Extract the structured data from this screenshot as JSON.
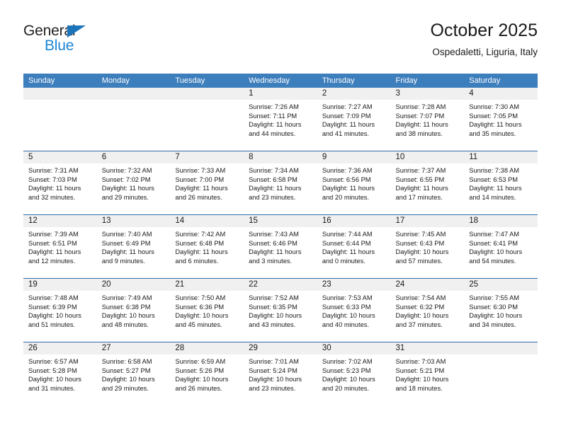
{
  "brand": {
    "name_part1": "General",
    "name_part2": "Blue",
    "accent_color": "#1c85d6",
    "triangle_color": "#1c74bb"
  },
  "header": {
    "title": "October 2025",
    "subtitle": "Ospedaletti, Liguria, Italy"
  },
  "theme": {
    "header_bg": "#3d7ebc",
    "date_band_bg": "#f0f0f0",
    "rule_color": "#2e6da4",
    "text_color": "#1a1a1a"
  },
  "weekdays": [
    "Sunday",
    "Monday",
    "Tuesday",
    "Wednesday",
    "Thursday",
    "Friday",
    "Saturday"
  ],
  "weeks": [
    {
      "days": [
        {
          "date": "",
          "info": ""
        },
        {
          "date": "",
          "info": ""
        },
        {
          "date": "",
          "info": ""
        },
        {
          "date": "1",
          "info": "Sunrise: 7:26 AM\nSunset: 7:11 PM\nDaylight: 11 hours\nand 44 minutes.",
          "sunrise": "7:26 AM",
          "sunset": "7:11 PM",
          "daylight": "11 hours and 44 minutes."
        },
        {
          "date": "2",
          "info": "Sunrise: 7:27 AM\nSunset: 7:09 PM\nDaylight: 11 hours\nand 41 minutes.",
          "sunrise": "7:27 AM",
          "sunset": "7:09 PM",
          "daylight": "11 hours and 41 minutes."
        },
        {
          "date": "3",
          "info": "Sunrise: 7:28 AM\nSunset: 7:07 PM\nDaylight: 11 hours\nand 38 minutes.",
          "sunrise": "7:28 AM",
          "sunset": "7:07 PM",
          "daylight": "11 hours and 38 minutes."
        },
        {
          "date": "4",
          "info": "Sunrise: 7:30 AM\nSunset: 7:05 PM\nDaylight: 11 hours\nand 35 minutes.",
          "sunrise": "7:30 AM",
          "sunset": "7:05 PM",
          "daylight": "11 hours and 35 minutes."
        }
      ]
    },
    {
      "days": [
        {
          "date": "5",
          "info": "Sunrise: 7:31 AM\nSunset: 7:03 PM\nDaylight: 11 hours\nand 32 minutes.",
          "sunrise": "7:31 AM",
          "sunset": "7:03 PM",
          "daylight": "11 hours and 32 minutes."
        },
        {
          "date": "6",
          "info": "Sunrise: 7:32 AM\nSunset: 7:02 PM\nDaylight: 11 hours\nand 29 minutes.",
          "sunrise": "7:32 AM",
          "sunset": "7:02 PM",
          "daylight": "11 hours and 29 minutes."
        },
        {
          "date": "7",
          "info": "Sunrise: 7:33 AM\nSunset: 7:00 PM\nDaylight: 11 hours\nand 26 minutes.",
          "sunrise": "7:33 AM",
          "sunset": "7:00 PM",
          "daylight": "11 hours and 26 minutes."
        },
        {
          "date": "8",
          "info": "Sunrise: 7:34 AM\nSunset: 6:58 PM\nDaylight: 11 hours\nand 23 minutes.",
          "sunrise": "7:34 AM",
          "sunset": "6:58 PM",
          "daylight": "11 hours and 23 minutes."
        },
        {
          "date": "9",
          "info": "Sunrise: 7:36 AM\nSunset: 6:56 PM\nDaylight: 11 hours\nand 20 minutes.",
          "sunrise": "7:36 AM",
          "sunset": "6:56 PM",
          "daylight": "11 hours and 20 minutes."
        },
        {
          "date": "10",
          "info": "Sunrise: 7:37 AM\nSunset: 6:55 PM\nDaylight: 11 hours\nand 17 minutes.",
          "sunrise": "7:37 AM",
          "sunset": "6:55 PM",
          "daylight": "11 hours and 17 minutes."
        },
        {
          "date": "11",
          "info": "Sunrise: 7:38 AM\nSunset: 6:53 PM\nDaylight: 11 hours\nand 14 minutes.",
          "sunrise": "7:38 AM",
          "sunset": "6:53 PM",
          "daylight": "11 hours and 14 minutes."
        }
      ]
    },
    {
      "days": [
        {
          "date": "12",
          "info": "Sunrise: 7:39 AM\nSunset: 6:51 PM\nDaylight: 11 hours\nand 12 minutes.",
          "sunrise": "7:39 AM",
          "sunset": "6:51 PM",
          "daylight": "11 hours and 12 minutes."
        },
        {
          "date": "13",
          "info": "Sunrise: 7:40 AM\nSunset: 6:49 PM\nDaylight: 11 hours\nand 9 minutes.",
          "sunrise": "7:40 AM",
          "sunset": "6:49 PM",
          "daylight": "11 hours and 9 minutes."
        },
        {
          "date": "14",
          "info": "Sunrise: 7:42 AM\nSunset: 6:48 PM\nDaylight: 11 hours\nand 6 minutes.",
          "sunrise": "7:42 AM",
          "sunset": "6:48 PM",
          "daylight": "11 hours and 6 minutes."
        },
        {
          "date": "15",
          "info": "Sunrise: 7:43 AM\nSunset: 6:46 PM\nDaylight: 11 hours\nand 3 minutes.",
          "sunrise": "7:43 AM",
          "sunset": "6:46 PM",
          "daylight": "11 hours and 3 minutes."
        },
        {
          "date": "16",
          "info": "Sunrise: 7:44 AM\nSunset: 6:44 PM\nDaylight: 11 hours\nand 0 minutes.",
          "sunrise": "7:44 AM",
          "sunset": "6:44 PM",
          "daylight": "11 hours and 0 minutes."
        },
        {
          "date": "17",
          "info": "Sunrise: 7:45 AM\nSunset: 6:43 PM\nDaylight: 10 hours\nand 57 minutes.",
          "sunrise": "7:45 AM",
          "sunset": "6:43 PM",
          "daylight": "10 hours and 57 minutes."
        },
        {
          "date": "18",
          "info": "Sunrise: 7:47 AM\nSunset: 6:41 PM\nDaylight: 10 hours\nand 54 minutes.",
          "sunrise": "7:47 AM",
          "sunset": "6:41 PM",
          "daylight": "10 hours and 54 minutes."
        }
      ]
    },
    {
      "days": [
        {
          "date": "19",
          "info": "Sunrise: 7:48 AM\nSunset: 6:39 PM\nDaylight: 10 hours\nand 51 minutes.",
          "sunrise": "7:48 AM",
          "sunset": "6:39 PM",
          "daylight": "10 hours and 51 minutes."
        },
        {
          "date": "20",
          "info": "Sunrise: 7:49 AM\nSunset: 6:38 PM\nDaylight: 10 hours\nand 48 minutes.",
          "sunrise": "7:49 AM",
          "sunset": "6:38 PM",
          "daylight": "10 hours and 48 minutes."
        },
        {
          "date": "21",
          "info": "Sunrise: 7:50 AM\nSunset: 6:36 PM\nDaylight: 10 hours\nand 45 minutes.",
          "sunrise": "7:50 AM",
          "sunset": "6:36 PM",
          "daylight": "10 hours and 45 minutes."
        },
        {
          "date": "22",
          "info": "Sunrise: 7:52 AM\nSunset: 6:35 PM\nDaylight: 10 hours\nand 43 minutes.",
          "sunrise": "7:52 AM",
          "sunset": "6:35 PM",
          "daylight": "10 hours and 43 minutes."
        },
        {
          "date": "23",
          "info": "Sunrise: 7:53 AM\nSunset: 6:33 PM\nDaylight: 10 hours\nand 40 minutes.",
          "sunrise": "7:53 AM",
          "sunset": "6:33 PM",
          "daylight": "10 hours and 40 minutes."
        },
        {
          "date": "24",
          "info": "Sunrise: 7:54 AM\nSunset: 6:32 PM\nDaylight: 10 hours\nand 37 minutes.",
          "sunrise": "7:54 AM",
          "sunset": "6:32 PM",
          "daylight": "10 hours and 37 minutes."
        },
        {
          "date": "25",
          "info": "Sunrise: 7:55 AM\nSunset: 6:30 PM\nDaylight: 10 hours\nand 34 minutes.",
          "sunrise": "7:55 AM",
          "sunset": "6:30 PM",
          "daylight": "10 hours and 34 minutes."
        }
      ]
    },
    {
      "days": [
        {
          "date": "26",
          "info": "Sunrise: 6:57 AM\nSunset: 5:28 PM\nDaylight: 10 hours\nand 31 minutes.",
          "sunrise": "6:57 AM",
          "sunset": "5:28 PM",
          "daylight": "10 hours and 31 minutes."
        },
        {
          "date": "27",
          "info": "Sunrise: 6:58 AM\nSunset: 5:27 PM\nDaylight: 10 hours\nand 29 minutes.",
          "sunrise": "6:58 AM",
          "sunset": "5:27 PM",
          "daylight": "10 hours and 29 minutes."
        },
        {
          "date": "28",
          "info": "Sunrise: 6:59 AM\nSunset: 5:26 PM\nDaylight: 10 hours\nand 26 minutes.",
          "sunrise": "6:59 AM",
          "sunset": "5:26 PM",
          "daylight": "10 hours and 26 minutes."
        },
        {
          "date": "29",
          "info": "Sunrise: 7:01 AM\nSunset: 5:24 PM\nDaylight: 10 hours\nand 23 minutes.",
          "sunrise": "7:01 AM",
          "sunset": "5:24 PM",
          "daylight": "10 hours and 23 minutes."
        },
        {
          "date": "30",
          "info": "Sunrise: 7:02 AM\nSunset: 5:23 PM\nDaylight: 10 hours\nand 20 minutes.",
          "sunrise": "7:02 AM",
          "sunset": "5:23 PM",
          "daylight": "10 hours and 20 minutes."
        },
        {
          "date": "31",
          "info": "Sunrise: 7:03 AM\nSunset: 5:21 PM\nDaylight: 10 hours\nand 18 minutes.",
          "sunrise": "7:03 AM",
          "sunset": "5:21 PM",
          "daylight": "10 hours and 18 minutes."
        },
        {
          "date": "",
          "info": ""
        }
      ]
    }
  ]
}
